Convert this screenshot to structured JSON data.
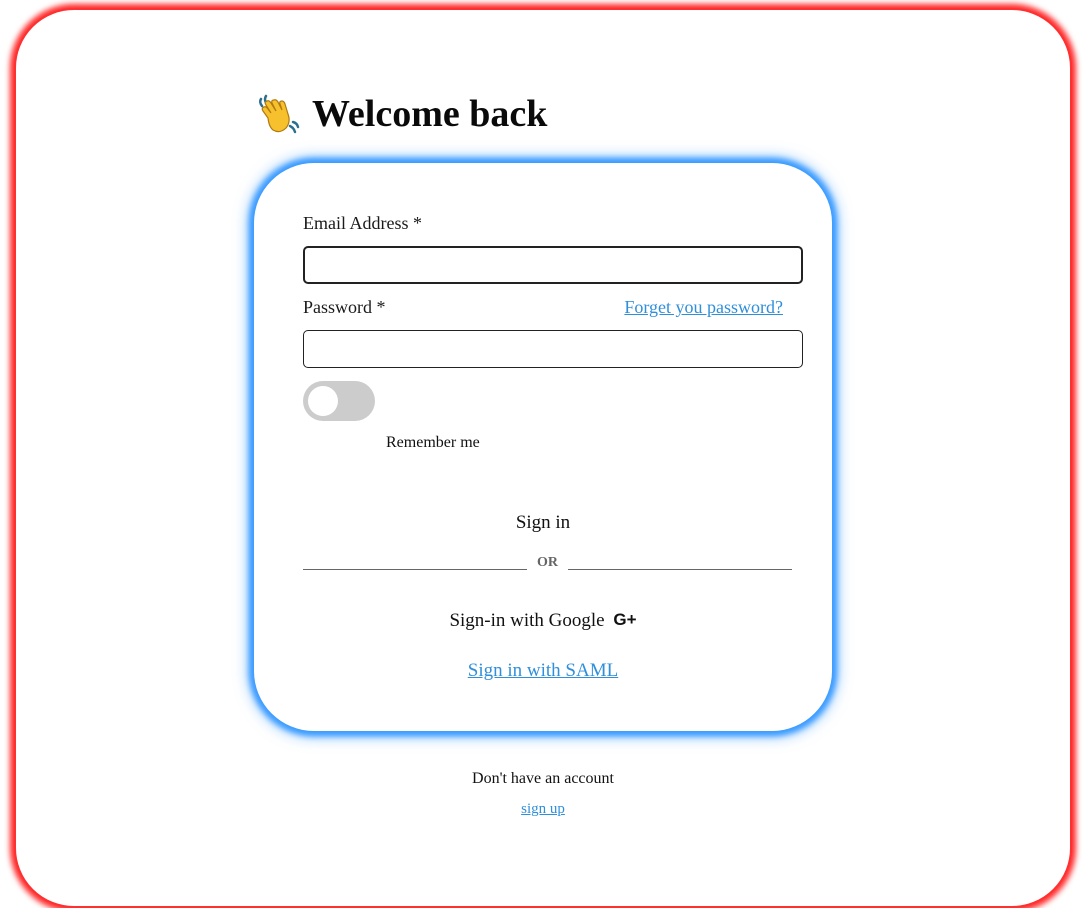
{
  "page": {
    "title": "Welcome back",
    "title_icon": "waving-hand-icon"
  },
  "form": {
    "email_label": "Email Address *",
    "email_value": "",
    "password_label": "Password *",
    "password_value": "",
    "forgot_link": "Forget you password?",
    "remember_label": "Remember me",
    "remember_checked": false,
    "signin_label": "Sign in",
    "divider_text": "OR",
    "google_label": "Sign-in with Google",
    "google_icon_text": "G+",
    "saml_link": "Sign in with SAML"
  },
  "footer": {
    "no_account_text": "Don't have an account",
    "signup_link": "sign up"
  },
  "colors": {
    "outer_glow": "#ff2a2a",
    "card_glow": "#3a9bff",
    "link": "#2f8fdb",
    "toggle_off": "#cccccc"
  }
}
